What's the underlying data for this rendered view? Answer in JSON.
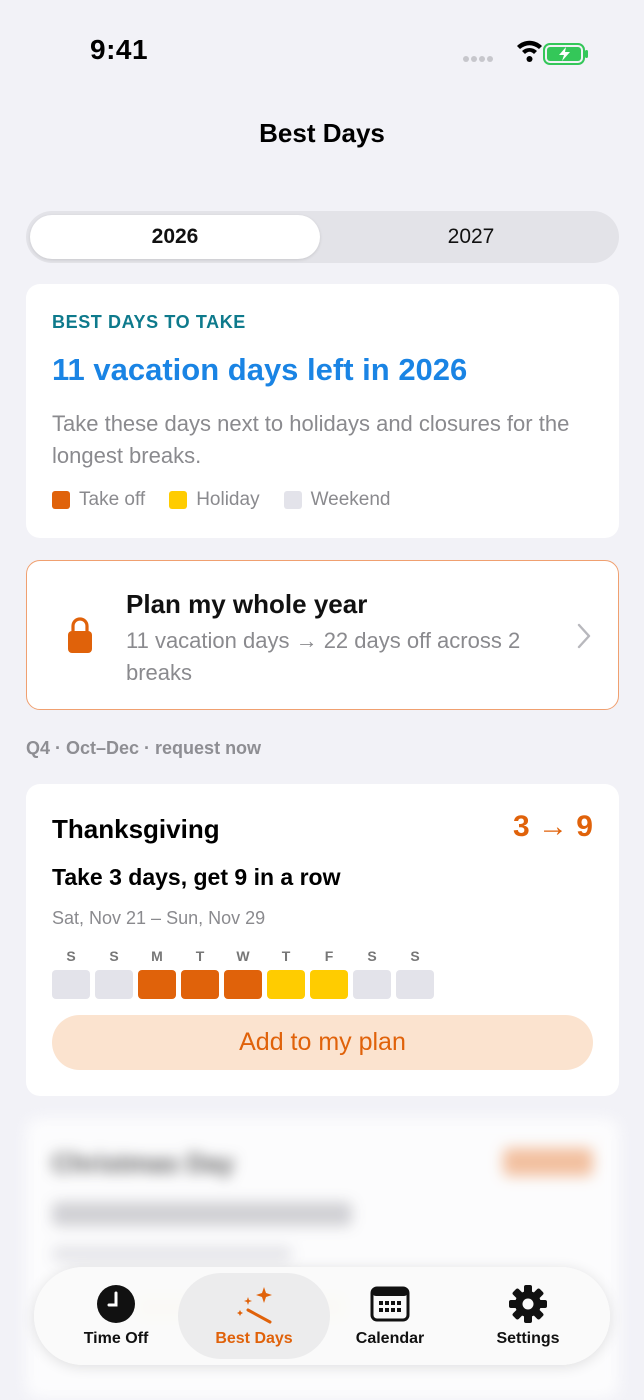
{
  "status_bar": {
    "time": "9:41"
  },
  "page_title": "Best Days",
  "year_segment": {
    "selected": "2026",
    "other": "2027"
  },
  "intro_card": {
    "eyebrow": "BEST DAYS TO TAKE",
    "headline": "11 vacation days left in 2026",
    "description": "Take these days next to holidays and closures for the longest breaks.",
    "legend": [
      {
        "label": "Take off",
        "color": "#e0620a"
      },
      {
        "label": "Holiday",
        "color": "#ffcc00"
      },
      {
        "label": "Weekend",
        "color": "#e3e3ea"
      }
    ]
  },
  "plan_card": {
    "title": "Plan my whole year",
    "subtitle": "11 vacation days → 22 days off across 2 breaks",
    "icon": "lock-icon"
  },
  "section_label": "Q4 · Oct–Dec · request now",
  "best_day_card": {
    "title": "Thanksgiving",
    "ratio": "3 → 9",
    "subtitle": "Take 3 days, get 9 in a row",
    "dates": "Sat, Nov 21 – Sun, Nov 29",
    "days": [
      {
        "letter": "S",
        "kind": "weekend"
      },
      {
        "letter": "S",
        "kind": "weekend"
      },
      {
        "letter": "M",
        "kind": "takeoff"
      },
      {
        "letter": "T",
        "kind": "takeoff"
      },
      {
        "letter": "W",
        "kind": "takeoff"
      },
      {
        "letter": "T",
        "kind": "holiday"
      },
      {
        "letter": "F",
        "kind": "holiday"
      },
      {
        "letter": "S",
        "kind": "weekend"
      },
      {
        "letter": "S",
        "kind": "weekend"
      }
    ],
    "button": "Add to my plan"
  },
  "next_card": {
    "title": "Christmas Day",
    "ratio": "",
    "subtitle": ""
  },
  "tab_bar": [
    {
      "label": "Time Off",
      "icon": "clock-icon",
      "active": false
    },
    {
      "label": "Best Days",
      "icon": "magic-wand-icon",
      "active": true
    },
    {
      "label": "Calendar",
      "icon": "calendar-icon",
      "active": false
    },
    {
      "label": "Settings",
      "icon": "gear-icon",
      "active": false
    }
  ],
  "colors": {
    "accent": "#e0620a",
    "link_blue": "#1a84e4",
    "eyebrow_teal": "#0e7a8c",
    "holiday": "#ffcc00",
    "weekend": "#e3e3ea"
  }
}
